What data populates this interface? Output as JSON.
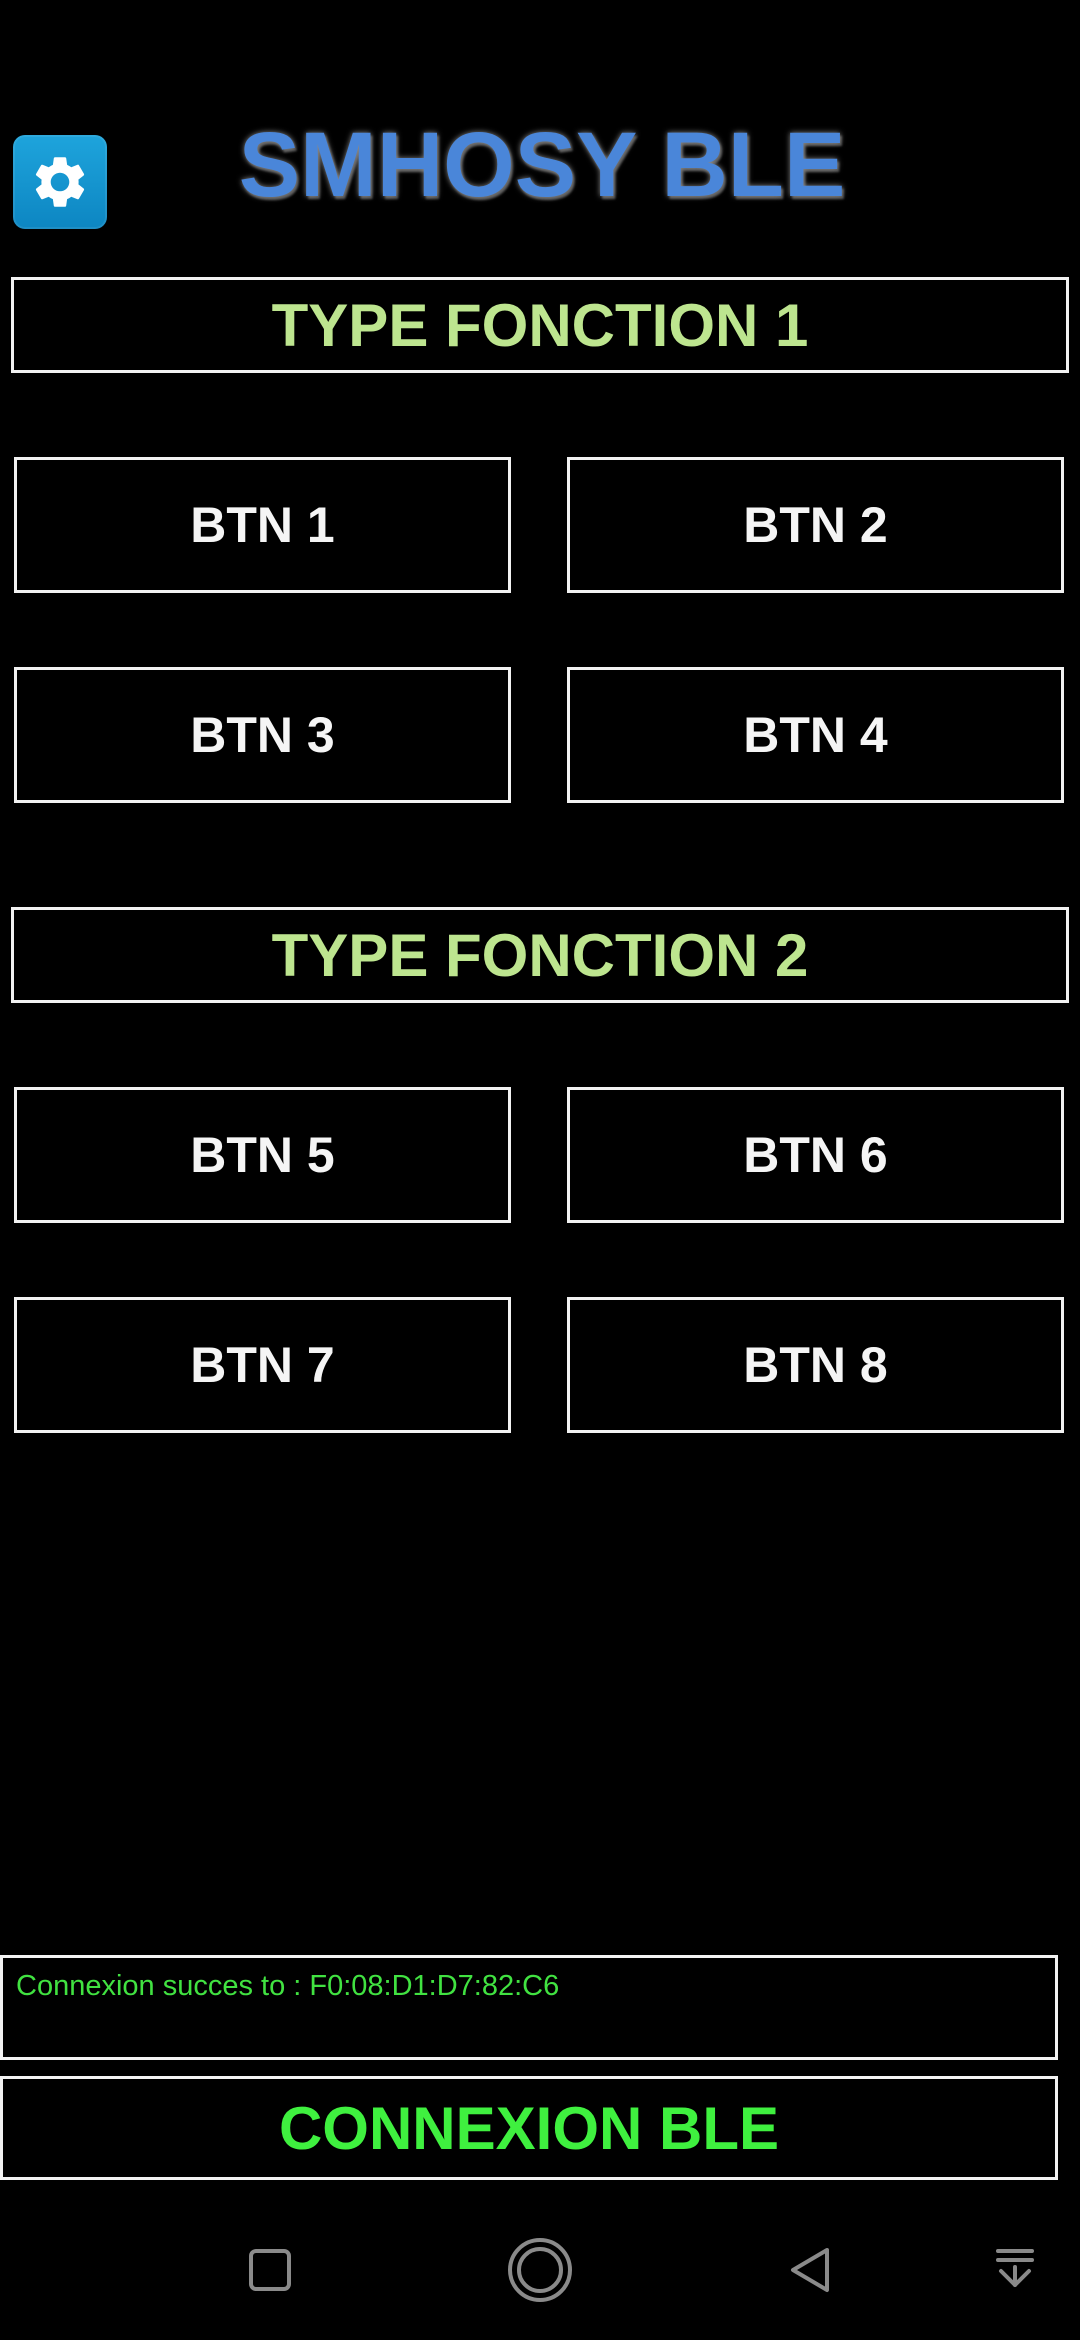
{
  "header": {
    "title": "SMHOSY BLE",
    "settings_icon": "gear-icon",
    "title_color": "#4a86d9"
  },
  "sections": [
    {
      "title": "TYPE FONCTION 1",
      "buttons": [
        "BTN 1",
        "BTN 2",
        "BTN 3",
        "BTN 4"
      ]
    },
    {
      "title": "TYPE FONCTION 2",
      "buttons": [
        "BTN 5",
        "BTN 6",
        "BTN 7",
        "BTN 8"
      ]
    }
  ],
  "status": {
    "text": "Connexion succes to : F0:08:D1:D7:82:C6",
    "color": "#41e241"
  },
  "connect_button": {
    "label": "CONNEXION BLE",
    "color": "#3ff03f"
  },
  "navbar": {
    "icons": [
      "recents-square-icon",
      "home-circle-icon",
      "back-triangle-icon",
      "notification-pull-icon"
    ]
  },
  "colors": {
    "background": "#000000",
    "section_title": "#bde58f",
    "button_text": "#f5f5f5",
    "border": "#f2f2f2"
  }
}
